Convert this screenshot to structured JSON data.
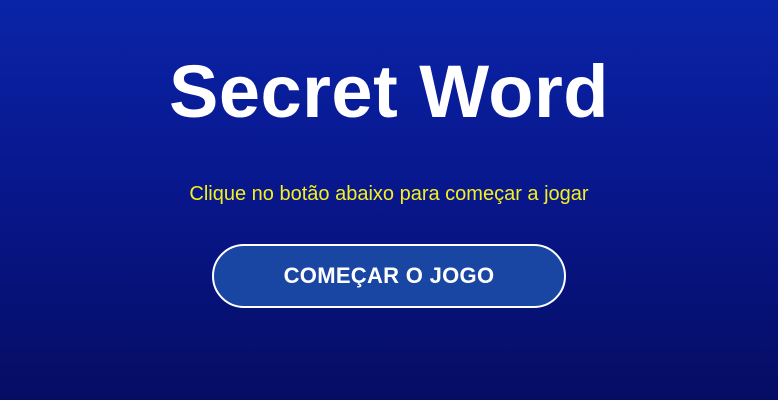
{
  "game": {
    "title": "Secret Word",
    "instruction": "Clique no botão abaixo para começar a jogar",
    "start_button_label": "COMEÇAR O JOGO"
  },
  "colors": {
    "background_top": "#0a24a8",
    "background_bottom": "#050d63",
    "title": "#ffffff",
    "instruction": "#f4f020",
    "button_fill": "#1a46a3",
    "button_border": "#ffffff"
  }
}
